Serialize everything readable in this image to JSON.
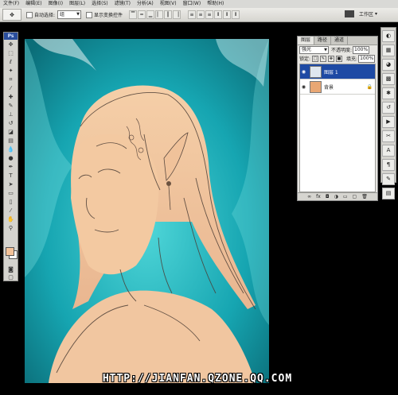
{
  "menu": [
    "文件(F)",
    "编辑(E)",
    "图像(I)",
    "图层(L)",
    "选择(S)",
    "滤镜(T)",
    "分析(A)",
    "视图(V)",
    "窗口(W)",
    "帮助(H)"
  ],
  "options": {
    "auto_select_label": "自动选择:",
    "auto_select_value": "组",
    "show_transform_label": "显示变换控件",
    "workspace_label": "工作区"
  },
  "toolbox": {
    "logo": "Ps"
  },
  "layers_panel": {
    "tabs": [
      "图层",
      "路径",
      "通道"
    ],
    "blend_mode": "强光",
    "opacity_label": "不透明度:",
    "opacity_value": "100%",
    "lock_label": "锁定:",
    "fill_label": "填充:",
    "fill_value": "100%",
    "layers": [
      {
        "name": "图层 1",
        "selected": true
      },
      {
        "name": "背景",
        "selected": false
      }
    ]
  },
  "watermark": "HTTP://JIANFAN.QZONE.QQ.COM",
  "colors": {
    "foreground_swatch": "#f4c39a",
    "canvas_teal": "#1aa7b3",
    "skin": "#f3c9a1",
    "selected_layer": "#1e4aa4"
  }
}
